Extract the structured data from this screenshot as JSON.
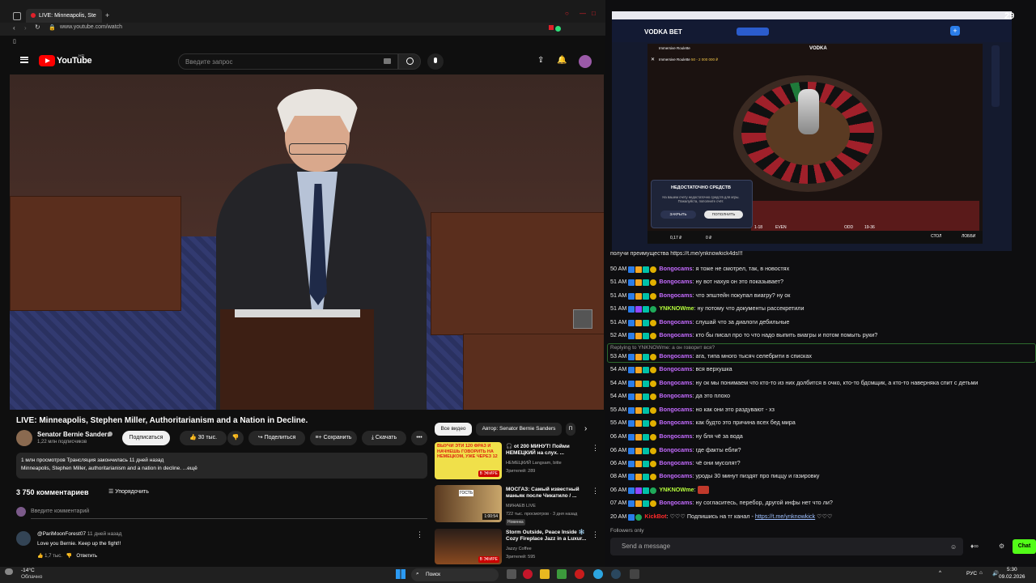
{
  "browser": {
    "tab_title": "LIVE: Minneapolis, Ste",
    "new_tab_symbol": "+",
    "url": "www.youtube.com/watch"
  },
  "youtube": {
    "logo_text": "YouTube",
    "logo_region": "HR",
    "search_placeholder": "Введите запрос",
    "video": {
      "title": "LIVE: Minneapolis, Stephen Miller, Authoritarianism and a Nation in Decline."
    },
    "channel": {
      "name": "Senator Bernie Sanders",
      "subscribers": "1,22 млн подписчиков",
      "subscribe_label": "Подписаться"
    },
    "actions": {
      "likes": "30 тыс.",
      "share": "Поделиться",
      "save": "Сохранить",
      "download": "Скачать",
      "more": "•••"
    },
    "description": {
      "line1": "1 млн просмотров  Трансляция закончилась 11 дней назад",
      "line2": "Minneapolis, Stephen Miller, authoritarianism and a nation in decline. ...ещё"
    },
    "comments": {
      "count_label": "3 750 комментариев",
      "sort_label": "Упорядочить",
      "input_placeholder": "Введите комментарий",
      "items": [
        {
          "author": "@PariMoonForest07",
          "time": "11 дней назад",
          "text": "Love you Bernie. Keep up the fight!!",
          "likes": "1,7 тыс.",
          "reply": "Ответить"
        }
      ]
    },
    "related": {
      "chips": [
        "Все видео",
        "Автор: Senator Bernie Sanders",
        "П"
      ],
      "items": [
        {
          "thumb_text": "ВЫУЧИ ЭТИ 120 ФРАЗ И НАЧНЕШЬ ГОВОРИТЬ НА НЕМЕЦКОМ, УЖЕ ЧЕРЕЗ 12",
          "thumb_badge": "В ЭФИРЕ",
          "title": "🎧 ot 200 МИНУТ! Пойми НЕМЕЦКИЙ на слух. ...",
          "channel": "НЕМЕЦКИЙ Langsam, bitte",
          "meta": "Зрителей: 289"
        },
        {
          "thumb_text": "ГОСТЬ",
          "thumb_badge": "1:00:54",
          "title": "МОСГАЗ: Самый известный маньяк после Чикатило / ...",
          "channel": "МИНАЕВ LIVE",
          "meta": "722 тыс. просмотров · 3 дня назад",
          "badge": "Новинка"
        },
        {
          "thumb_text": "",
          "thumb_badge": "В ЭФИРЕ",
          "title": "Storm Outside, Peace Inside ❄️ Cozy Fireplace Jazz in a Luxur...",
          "channel": "Jazzy Coffee",
          "meta": "Зрителей: 595"
        }
      ]
    }
  },
  "casino": {
    "brand": "VODKA BET",
    "game_brand": "VODKA",
    "game_title": "Immersive Roulette",
    "game_limits": "50 - 2 000 000 ₽",
    "corner_count": "29",
    "modal": {
      "title": "НЕДОСТАТОЧНО СРЕДСТВ",
      "text": "На вашем счету недостаточно средств для игры. Пожалуйста, пополните счёт.",
      "close_btn": "ЗАКРЫТЬ",
      "topup_btn": "ПОПОЛНИТЬ"
    },
    "board_labels": [
      "1-18",
      "EVEN",
      "ODD",
      "19-36"
    ],
    "balance": "0,17 ₽",
    "bet": "0 ₽",
    "stop_label": "СТОЛ",
    "lobby_label": "ЛОББИ"
  },
  "chat": {
    "header_partial": "получи преимущества https://t.me/ynknowkick4ds!!!",
    "reply_note": "Replying to YNKNOWme: а он говорит вся?",
    "messages": [
      {
        "time": "50 AM",
        "user": "Bongocams",
        "kind": "bongo",
        "text": "я тоже не смотрел, так, в новостях"
      },
      {
        "time": "51 AM",
        "user": "Bongocams",
        "kind": "bongo",
        "text": "ну вот нахуя он это показывает?"
      },
      {
        "time": "51 AM",
        "user": "Bongocams",
        "kind": "bongo",
        "text": "что эпштейн покупал виагру? ну ок"
      },
      {
        "time": "51 AM",
        "user": "YNKNOWme",
        "kind": "ynk",
        "text": "ну потому что документы рассекретили"
      },
      {
        "time": "51 AM",
        "user": "Bongocams",
        "kind": "bongo",
        "text": "слушай что за диалоги дебильные"
      },
      {
        "time": "52 AM",
        "user": "Bongocams",
        "kind": "bongo",
        "text": "кто бы писал про то что надо выпить виагры и потом помыть руки?"
      },
      {
        "time": "53 AM",
        "user": "Bongocams",
        "kind": "bongo",
        "text": "ага, типа много тысяч селебрити в списках"
      },
      {
        "time": "54 AM",
        "user": "Bongocams",
        "kind": "bongo",
        "text": "вся верхушка"
      },
      {
        "time": "54 AM",
        "user": "Bongocams",
        "kind": "bongo",
        "text": "ну ок мы понимаем что кто-то из них долбится в очко, кто-то бдсмщик, а кто-то наверняка спит с детьми"
      },
      {
        "time": "54 AM",
        "user": "Bongocams",
        "kind": "bongo",
        "text": "да это плохо"
      },
      {
        "time": "55 AM",
        "user": "Bongocams",
        "kind": "bongo",
        "text": "но как они это раздувают - хз"
      },
      {
        "time": "55 AM",
        "user": "Bongocams",
        "kind": "bongo",
        "text": "как будто это причина всех бед мира"
      },
      {
        "time": "06 AM",
        "user": "Bongocams",
        "kind": "bongo",
        "text": "ну бля чё за вода"
      },
      {
        "time": "06 AM",
        "user": "Bongocams",
        "kind": "bongo",
        "text": "где факты ебли?"
      },
      {
        "time": "06 AM",
        "user": "Bongocams",
        "kind": "bongo",
        "text": "чё они мусолят?"
      },
      {
        "time": "08 AM",
        "user": "Bongocams",
        "kind": "bongo",
        "text": "уроды 30 минут пиздят про пиццу и газировку"
      },
      {
        "time": "06 AM",
        "user": "YNKNOWme",
        "kind": "ynk",
        "text": ""
      },
      {
        "time": "07 AM",
        "user": "Bongocams",
        "kind": "bongo",
        "text": "ну согласитесь, перебор, другой инфы нет что ли?"
      },
      {
        "time": "20 AM",
        "user": "KickBot",
        "kind": "kick",
        "text": "♡♡♡ Подпишись на тг канал - ",
        "link": "https://t.me/ynknowkick",
        "suffix": " ♡♡♡"
      }
    ],
    "followers_only": "Followers only",
    "input_placeholder": "Send a message",
    "chat_button": "Chat"
  },
  "taskbar": {
    "weather_temp": "-14°C",
    "weather_desc": "Облачно",
    "search_label": "Поиск",
    "lang": "РУС",
    "time": "5:30",
    "date": "09.02.2026"
  }
}
